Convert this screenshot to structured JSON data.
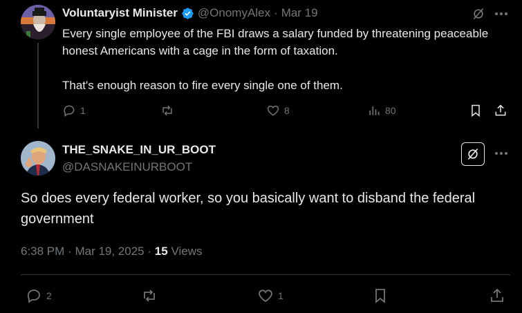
{
  "parent_tweet": {
    "display_name": "Voluntaryist Minister",
    "handle": "@OnomyAlex",
    "separator": "·",
    "date": "Mar 19",
    "text": "Every single employee of the FBI draws a salary funded by threatening peaceable honest Americans with a cage in the form of taxation.\n\nThat's enough reason to fire every single one of them.",
    "replies": "1",
    "reposts": "",
    "likes": "8",
    "views": "80"
  },
  "main_tweet": {
    "display_name": "THE_SNAKE_IN_UR_BOOT",
    "handle": "@DASNAKEINURBOOT",
    "text": "So does every federal worker, so you basically want to disband the federal government",
    "time": "6:38 PM",
    "date": "Mar 19, 2025",
    "views_count": "15",
    "views_label": "Views",
    "replies": "2",
    "reposts": "",
    "likes": "1"
  },
  "colors": {
    "background": "#000000",
    "text": "#e7e9ea",
    "muted": "#71767b",
    "verified": "#1d9bf0",
    "divider": "#2f3336"
  },
  "icons": [
    "verified-badge-icon",
    "grok-icon",
    "more-icon",
    "reply-icon",
    "repost-icon",
    "like-icon",
    "views-icon",
    "bookmark-icon",
    "share-icon"
  ]
}
